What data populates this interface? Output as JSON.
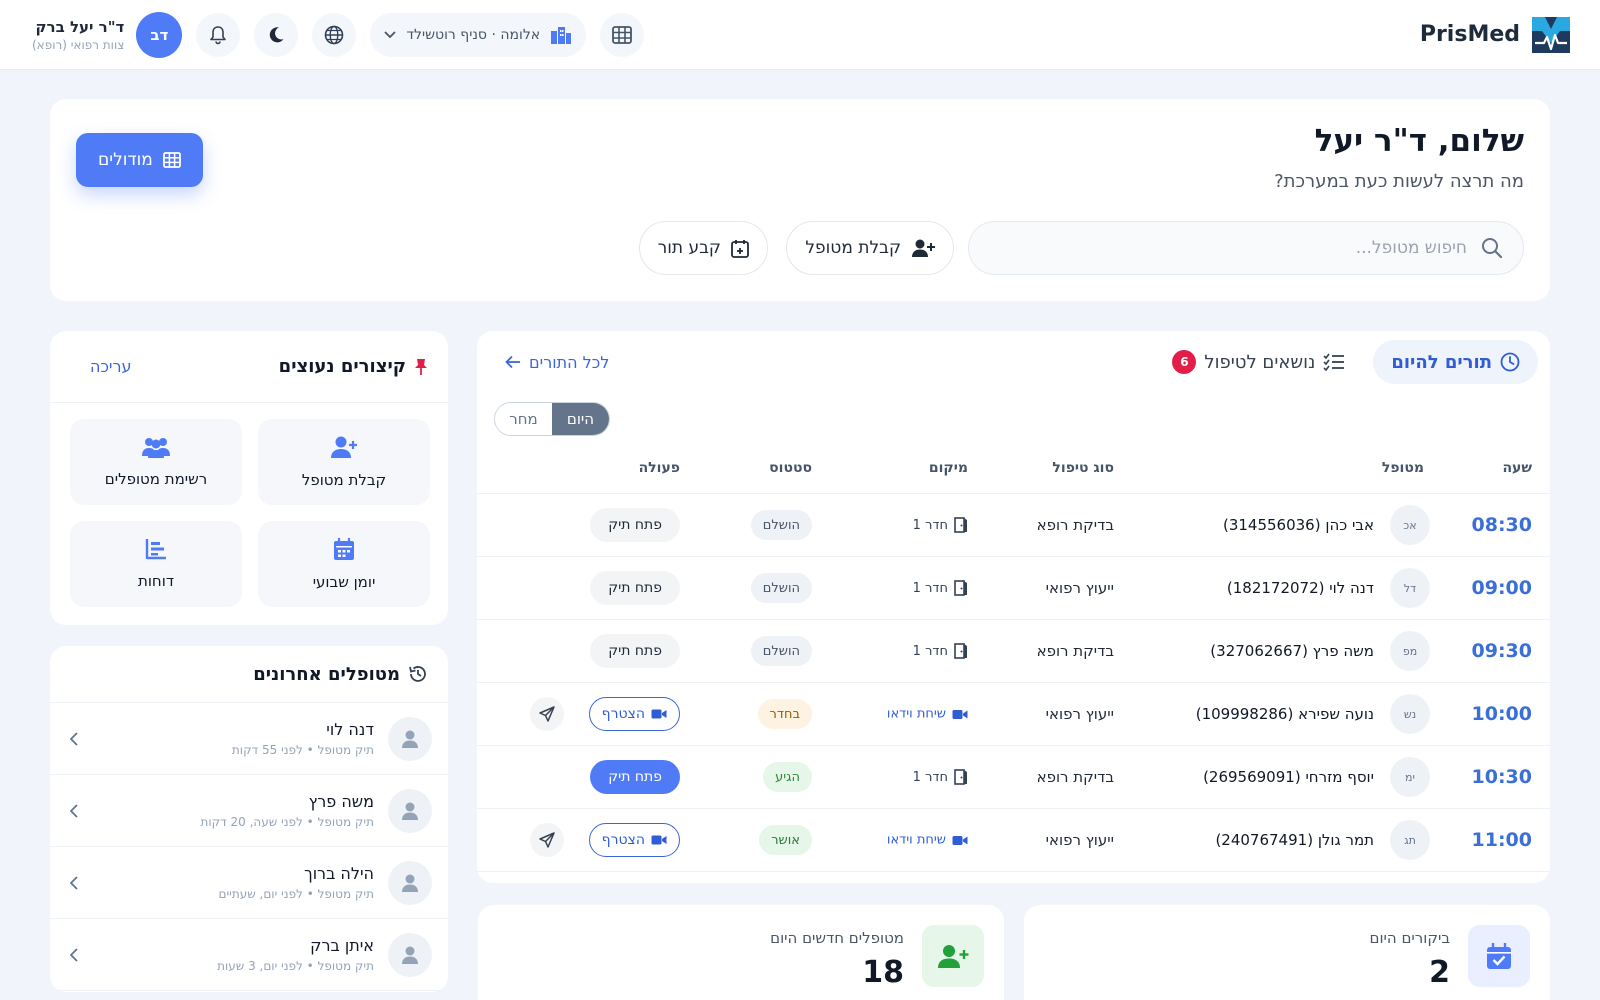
{
  "header": {
    "brand": "PrisMed",
    "branch": "אלומה · סניף רוטשילד",
    "user": {
      "initials": "דב",
      "name": "ד\"ר יעל ברק",
      "role": "צוות רפואי (רופא)"
    }
  },
  "hero": {
    "title": "שלום, ד\"ר יעל",
    "subtitle": "מה תרצה לעשות כעת במערכת?",
    "search_placeholder": "חיפוש מטופל...",
    "intake_label": "קבלת מטופל",
    "schedule_label": "קבע תור",
    "modules_label": "מודולים"
  },
  "appointments": {
    "tab_today": "תורים להיום",
    "tab_tasks": "נושאים לטיפול",
    "tasks_count": "6",
    "all_link": "לכל התורים",
    "toggle": {
      "today": "היום",
      "tomorrow": "מחר"
    },
    "columns": {
      "time": "שעה",
      "patient": "מטופל",
      "type": "סוג טיפול",
      "location": "מיקום",
      "status": "סטטוס",
      "action": "פעולה"
    },
    "rows": [
      {
        "time": "08:30",
        "initials": "אכ",
        "name": "אבי כהן (314556036)",
        "type": "בדיקת רופא",
        "location": "חדר 1",
        "location_kind": "room",
        "status": "הושלם",
        "status_kind": "done",
        "action": "פתח תיק",
        "action_kind": "open"
      },
      {
        "time": "09:00",
        "initials": "דל",
        "name": "דנה לוי (182172072)",
        "type": "ייעוץ רפואי",
        "location": "חדר 1",
        "location_kind": "room",
        "status": "הושלם",
        "status_kind": "done",
        "action": "פתח תיק",
        "action_kind": "open"
      },
      {
        "time": "09:30",
        "initials": "מפ",
        "name": "משה פרץ (327062667)",
        "type": "בדיקת רופא",
        "location": "חדר 1",
        "location_kind": "room",
        "status": "הושלם",
        "status_kind": "done",
        "action": "פתח תיק",
        "action_kind": "open"
      },
      {
        "time": "10:00",
        "initials": "נש",
        "name": "נועה שפירא (109998286)",
        "type": "ייעוץ רפואי",
        "location": "שיחת וידאו",
        "location_kind": "video",
        "status": "בחדר",
        "status_kind": "room",
        "action": "הצטרף",
        "action_kind": "join"
      },
      {
        "time": "10:30",
        "initials": "ימ",
        "name": "יוסף מזרחי (269569091)",
        "type": "בדיקת רופא",
        "location": "חדר 1",
        "location_kind": "room",
        "status": "הגיע",
        "status_kind": "arrived",
        "action": "פתח תיק",
        "action_kind": "primary"
      },
      {
        "time": "11:00",
        "initials": "תג",
        "name": "תמר גולן (240767491)",
        "type": "ייעוץ רפואי",
        "location": "שיחת וידאו",
        "location_kind": "video",
        "status": "אושר",
        "status_kind": "ok",
        "action": "הצטרף",
        "action_kind": "join"
      }
    ]
  },
  "shortcuts": {
    "title": "קיצורים נעוצים",
    "edit": "עריכה",
    "items": [
      "קבלת מטופל",
      "רשימת מטופלים",
      "יומן שבועי",
      "דוחות"
    ]
  },
  "recent": {
    "title": "מטופלים אחרונים",
    "items": [
      {
        "name": "דנה לוי",
        "meta": "תיק מטופל • לפני 55 דקות"
      },
      {
        "name": "משה פרץ",
        "meta": "תיק מטופל • לפני שעה, 20 דקות"
      },
      {
        "name": "הילה ברוך",
        "meta": "תיק מטופל • לפני יום, שעתיים"
      },
      {
        "name": "איתן ברק",
        "meta": "תיק מטופל • לפני יום, 3 שעות"
      }
    ]
  },
  "stats": {
    "visits": {
      "label": "ביקורים היום",
      "value": "2"
    },
    "new_patients": {
      "label": "מטופלים חדשים היום",
      "value": "18"
    }
  },
  "colors": {
    "accent": "#4f7cf6",
    "link": "#3b66d8",
    "danger": "#e11d48"
  }
}
